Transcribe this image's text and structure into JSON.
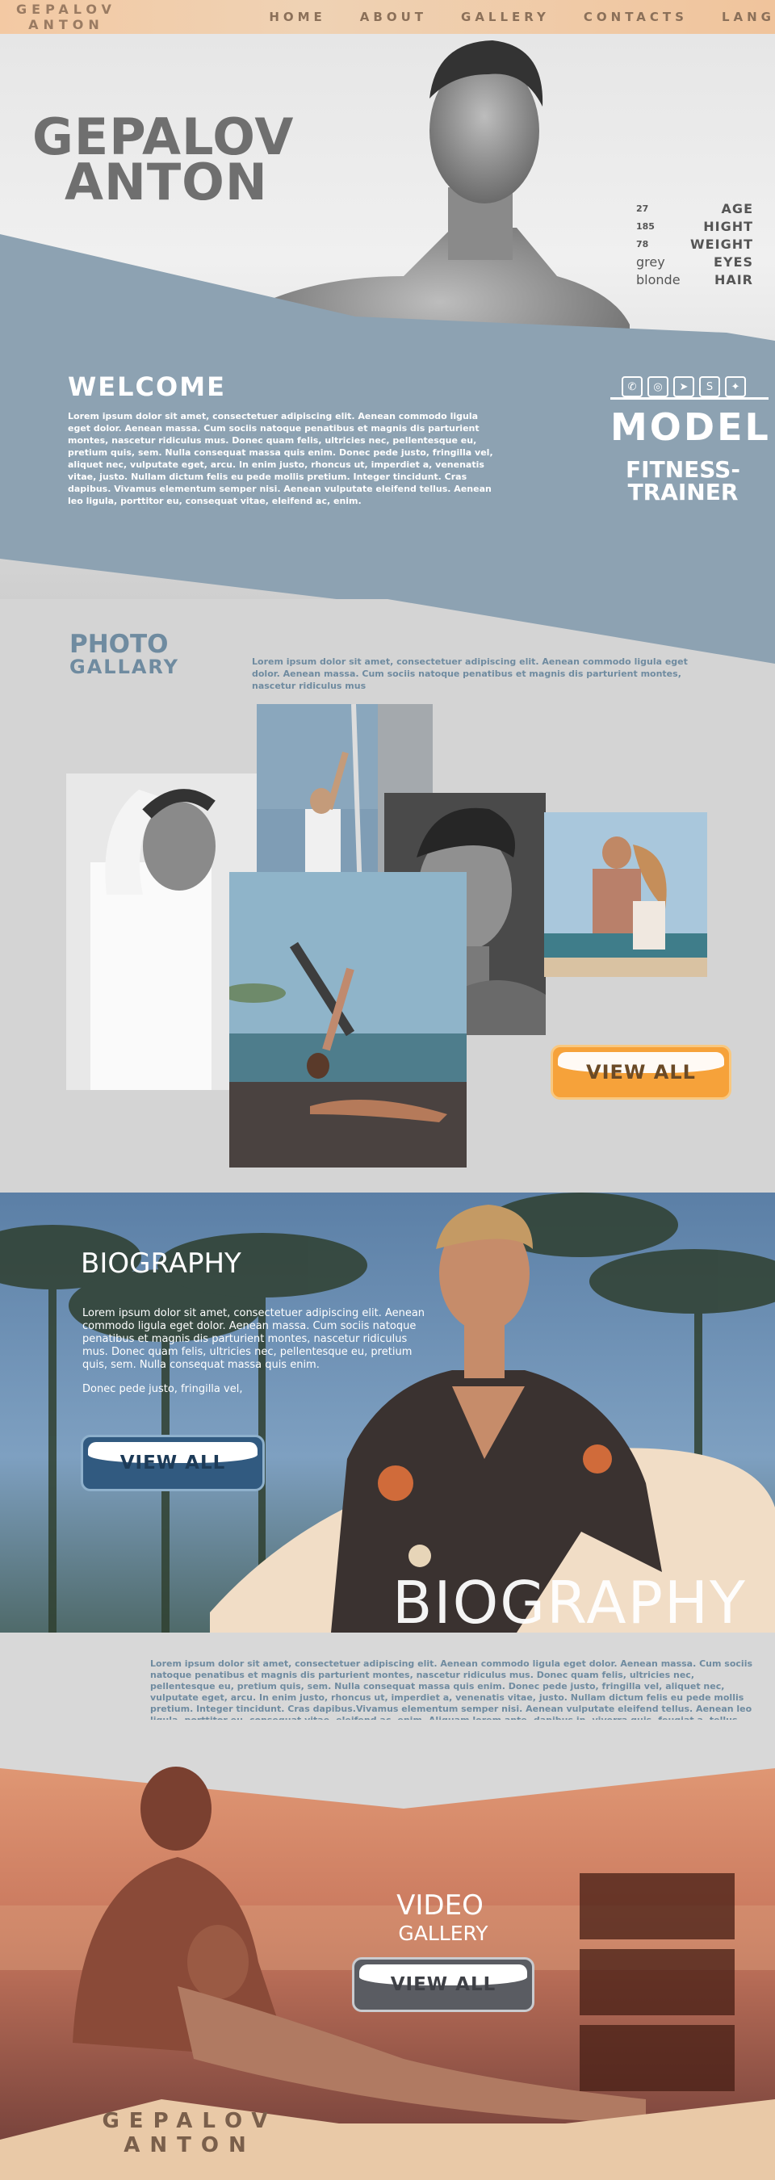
{
  "nav": {
    "logo_line1": "GEPALOV",
    "logo_line2": "ANTON",
    "links": [
      "HOME",
      "ABOUT",
      "GALLERY",
      "CONTACTS",
      "LANG"
    ]
  },
  "hero": {
    "name_line1": "GEPALOV",
    "name_line2": "ANTON",
    "stats": [
      {
        "value": "27",
        "label": "AGE"
      },
      {
        "value": "185",
        "label": "HIGHT"
      },
      {
        "value": "78",
        "label": "WEIGHT"
      },
      {
        "value": "grey",
        "label": "EYES"
      },
      {
        "value": "blonde",
        "label": "HAIR"
      }
    ]
  },
  "welcome": {
    "title": "WELCOME",
    "text": "Lorem ipsum dolor sit amet, consectetuer adipiscing elit. Aenean commodo ligula eget dolor. Aenean massa. Cum sociis natoque penatibus et magnis dis parturient montes, nascetur ridiculus mus. Donec quam felis, ultricies nec, pellentesque eu, pretium quis, sem. Nulla consequat massa quis enim. Donec pede justo, fringilla vel, aliquet nec, vulputate eget, arcu. In enim justo, rhoncus ut, imperdiet a, venenatis vitae, justo. Nullam dictum felis eu pede mollis pretium. Integer tincidunt. Cras dapibus. Vivamus elementum semper nisi. Aenean vulputate eleifend tellus. Aenean leo ligula, porttitor eu, consequat vitae, eleifend ac, enim.",
    "socials": [
      "whatsapp-icon",
      "instagram-icon",
      "telegram-icon",
      "skype-icon",
      "twitter-icon"
    ],
    "role1": "MODEL",
    "role2": "FITNESS-TRAINER"
  },
  "gallery": {
    "title_line1": "PHOTO",
    "title_line2": "GALLARY",
    "description": "Lorem ipsum dolor sit amet, consectetuer adipiscing elit. Aenean commodo ligula eget dolor. Aenean massa. Cum sociis natoque penatibus et magnis dis parturient montes, nascetur ridiculus mus",
    "view_all": "VIEW ALL",
    "accent": "#f6a23a"
  },
  "biography": {
    "title": "BIOGRAPHY",
    "paragraph1": "Lorem ipsum dolor sit amet, consectetuer adipiscing elit. Aenean commodo ligula eget dolor. Aenean massa. Cum sociis natoque penatibus et magnis dis parturient montes, nascetur ridiculus mus. Donec quam felis, ultricies nec, pellentesque eu, pretium quis, sem. Nulla consequat massa quis enim.",
    "paragraph2": "Donec pede justo, fringilla vel,",
    "view_all": "VIEW ALL",
    "big_title": "BIOGRAPHY",
    "long_text": "Lorem ipsum dolor sit amet, consectetuer adipiscing elit. Aenean commodo ligula eget dolor. Aenean massa. Cum sociis natoque penatibus et magnis dis parturient montes, nascetur ridiculus mus. Donec quam felis, ultricies nec, pellentesque eu, pretium quis, sem. Nulla consequat massa quis enim. Donec pede justo, fringilla vel, aliquet nec, vulputate eget, arcu. In enim justo, rhoncus ut, imperdiet a, venenatis vitae, justo. Nullam dictum felis eu pede mollis pretium. Integer tincidunt. Cras dapibus.Vivamus elementum semper nisi. Aenean vulputate eleifend tellus. Aenean leo ligula, porttitor eu, consequat vitae, eleifend ac, enim. Aliquam lorem ante, dapibus in, viverra quis, feugiat a, tellus. Phasellus viverra nulla ut metus varius laoreet."
  },
  "video": {
    "title": "VIDEO",
    "subtitle": "GALLERY",
    "view_all": "VIEW ALL"
  },
  "footer": {
    "logo_line1": "GEPALOV",
    "logo_line2": "ANTON"
  },
  "colors": {
    "nav_bg": "#f0c9a3",
    "steel_blue": "#8da2b2",
    "gallery_title": "#6f8ba0",
    "orange": "#f6a23a",
    "blue_button": "#315a80",
    "grey_button": "#5a5c62"
  }
}
